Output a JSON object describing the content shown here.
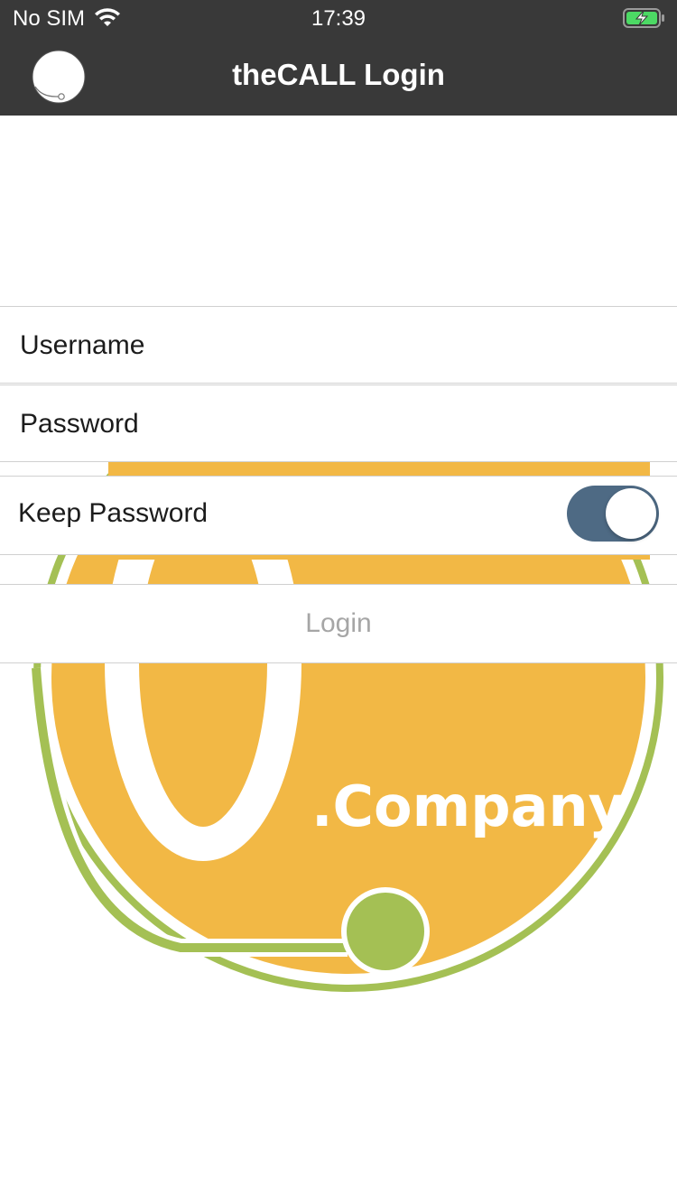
{
  "status_bar": {
    "carrier": "No SIM",
    "time": "17:39",
    "wifi_icon": "wifi-icon",
    "battery_icon": "battery-charging-icon"
  },
  "nav": {
    "title": "theCALL Login",
    "logo_icon": "app-logo-icon"
  },
  "form": {
    "username_placeholder": "Username",
    "password_placeholder": "Password",
    "keep_password_label": "Keep Password",
    "keep_password_on": true,
    "login_label": "Login"
  },
  "background_logo": {
    "text": ".Company",
    "colors": {
      "orange": "#f2b845",
      "green": "#a4c054"
    }
  },
  "colors": {
    "header_bg": "#393939",
    "toggle_on": "#4e6a84",
    "login_text": "#a6a6a6"
  }
}
